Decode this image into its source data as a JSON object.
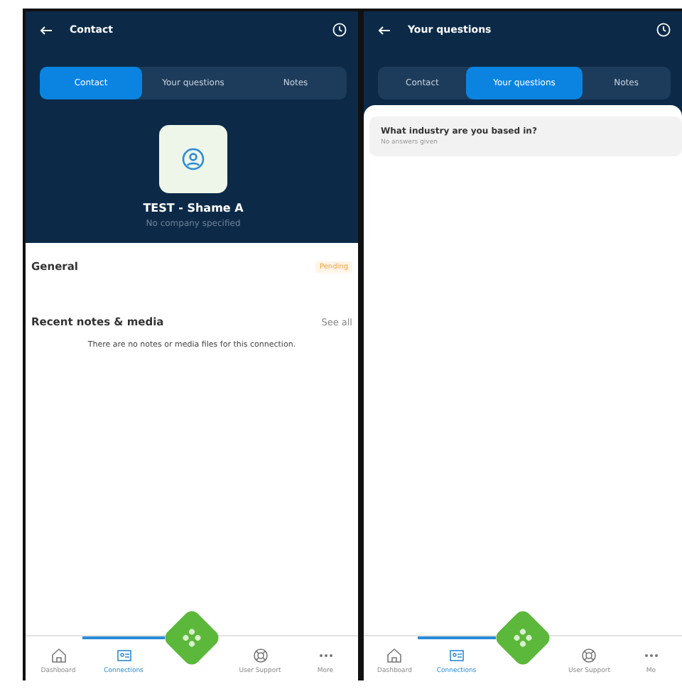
{
  "screens": [
    {
      "kind": "contact",
      "title": "Contact",
      "tabs": [
        {
          "label": "Contact",
          "selected": true
        },
        {
          "label": "Your questions",
          "selected": false
        },
        {
          "label": "Notes",
          "selected": false
        }
      ],
      "profile": {
        "name": "TEST - Shame A",
        "subtitle": "No company specified"
      },
      "general": {
        "label": "General",
        "badge": "Pending"
      },
      "notes": {
        "label": "Recent notes & media",
        "link": "See all",
        "empty": "There are no notes or media files for this connection."
      },
      "nav": [
        {
          "kind": "home",
          "label": "Dashboard",
          "selected": false
        },
        {
          "kind": "contacts",
          "label": "Connections",
          "selected": true
        },
        {
          "kind": "support",
          "label": "User Support",
          "selected": false
        },
        {
          "kind": "more",
          "label": "More",
          "selected": false
        }
      ]
    },
    {
      "kind": "questions",
      "title": "Your questions",
      "tabs": [
        {
          "label": "Contact",
          "selected": false
        },
        {
          "label": "Your questions",
          "selected": true
        },
        {
          "label": "Notes",
          "selected": false
        }
      ],
      "questions": [
        {
          "question": "What industry are you based in?",
          "answer": "No answers given"
        }
      ],
      "nav": [
        {
          "kind": "home",
          "label": "Dashboard",
          "selected": false
        },
        {
          "kind": "contacts",
          "label": "Connections",
          "selected": true
        },
        {
          "kind": "support",
          "label": "User Support",
          "selected": false
        },
        {
          "kind": "more",
          "label": "Mo",
          "selected": false
        }
      ]
    }
  ]
}
